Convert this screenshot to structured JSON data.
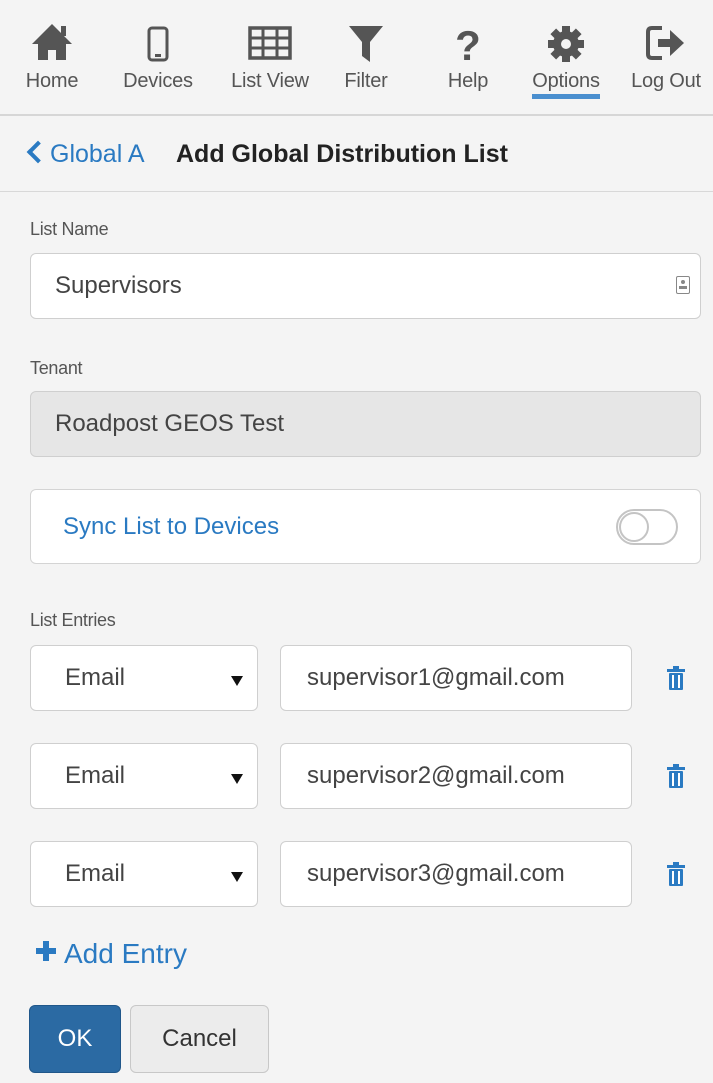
{
  "nav": [
    {
      "label": "Home",
      "icon": "home-icon"
    },
    {
      "label": "Devices",
      "icon": "mobile-device-icon"
    },
    {
      "label": "List View",
      "icon": "grid-icon"
    },
    {
      "label": "Filter",
      "icon": "filter-icon"
    },
    {
      "label": "Help",
      "icon": "help-icon"
    },
    {
      "label": "Options",
      "icon": "gear-icon",
      "active": true
    },
    {
      "label": "Log Out",
      "icon": "logout-icon"
    }
  ],
  "header": {
    "back_label": "Global A",
    "title": "Add Global Distribution List"
  },
  "form": {
    "list_name_label": "List Name",
    "list_name_value": "Supervisors",
    "tenant_label": "Tenant",
    "tenant_value": "Roadpost GEOS Test",
    "sync_label": "Sync List to Devices",
    "sync_enabled": false,
    "entries_label": "List Entries",
    "entries": [
      {
        "type": "Email",
        "value": "supervisor1@gmail.com"
      },
      {
        "type": "Email",
        "value": "supervisor2@gmail.com"
      },
      {
        "type": "Email",
        "value": "supervisor3@gmail.com"
      }
    ],
    "add_entry_label": "Add Entry"
  },
  "actions": {
    "ok_label": "OK",
    "cancel_label": "Cancel"
  },
  "colors": {
    "accent": "#2a7ac2",
    "primary_button": "#2b6aa3",
    "icon": "#555555"
  }
}
